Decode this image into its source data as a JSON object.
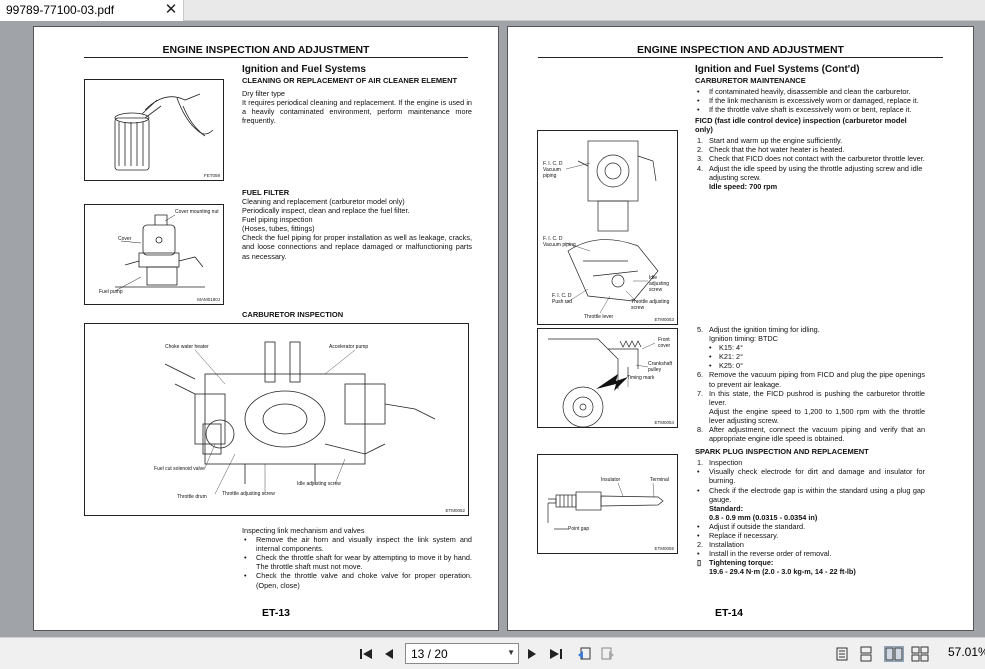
{
  "tab": {
    "title": "99789-77100-03.pdf",
    "close_label": "✕"
  },
  "left_page": {
    "header": "ENGINE INSPECTION AND ADJUSTMENT",
    "section_title": "Ignition and Fuel Systems",
    "air_cleaner": {
      "heading": "CLEANING OR REPLACEMENT OF AIR CLEANER ELEMENT",
      "line1": "Dry filter type",
      "body": "It requires periodical cleaning and replacement. If the engine is used in a heavily contaminated environment, perform maintenance more frequently."
    },
    "fuel_filter": {
      "heading": "FUEL FILTER",
      "lines": [
        "Cleaning and replacement (carburetor model only)",
        "Periodically inspect, clean and replace the fuel filter.",
        "Fuel piping inspection",
        "(Hoses, tubes, fittings)",
        "Check the fuel piping for proper installation as well as leakage, cracks, and loose connections and replace damaged or malfunctioning parts as necessary."
      ]
    },
    "carb_heading": "CARBURETOR INSPECTION",
    "link_intro": "Inspecting link mechanism and valves",
    "link_bullets": [
      "Remove the air horn and visually inspect the link system and internal components.",
      "Check the throttle shaft for wear by attempting to move it by hand. The throttle shaft must not move.",
      "Check the throttle valve and choke valve for proper operation. (Open, close)"
    ],
    "fig1": {
      "code": "FET059"
    },
    "fig2": {
      "code": "MAM0180J",
      "labels": {
        "cover_nut": "Cover mounting nut",
        "cover": "Cover",
        "pump": "Fuel pump"
      }
    },
    "fig3": {
      "code": "ETM0052",
      "labels": {
        "choke": "Choke water heater",
        "accel": "Accelerator pump",
        "solenoid": "Fuel cut solenoid valve",
        "drum": "Throttle drum",
        "adjusting": "Throttle adjusting screw",
        "idle": "Idle adjusting screw"
      }
    },
    "page_number": "ET-13"
  },
  "right_page": {
    "header": "ENGINE INSPECTION AND ADJUSTMENT",
    "section_title": "Ignition and Fuel Systems (Cont'd)",
    "carb_maint": {
      "heading": "CARBURETOR MAINTENANCE",
      "bullets": [
        "If contaminated heavily, disassemble and clean the carburetor.",
        "If the link mechanism is excessively worn or damaged, replace it.",
        "If the throttle valve shaft is excessively worn or bent, replace it."
      ]
    },
    "ficd": {
      "heading": "FICD (fast idle control device) inspection (carburetor model only)",
      "steps": [
        {
          "n": "1.",
          "t": "Start and warm up the engine sufficiently."
        },
        {
          "n": "2.",
          "t": "Check that the hot water heater is heated."
        },
        {
          "n": "3.",
          "t": "Check that FICD does not contact with the carburetor throttle lever."
        },
        {
          "n": "4.",
          "t": "Adjust the idle speed by using the throttle adjusting screw and idle adjusting screw."
        }
      ],
      "idle_speed": "Idle speed: 700 rpm"
    },
    "timing": {
      "step5": "Adjust the ignition timing for idling.",
      "timing_label": "Ignition timing: BTDC",
      "specs": [
        "K15: 4°",
        "K21: 2°",
        "K25: 0°"
      ],
      "steps": [
        {
          "n": "6.",
          "t": "Remove the vacuum piping from FICD and plug the pipe openings to prevent air leakage."
        },
        {
          "n": "7.",
          "t": "In this state, the FICD pushrod is pushing the carburetor throttle lever."
        }
      ],
      "step7b": "Adjust the engine speed to 1,200 to 1,500 rpm with the throttle lever adjusting screw.",
      "step8": "After adjustment, connect the vacuum piping and verify that an appropriate engine idle speed is obtained."
    },
    "spark": {
      "heading": "SPARK PLUG INSPECTION AND REPLACEMENT",
      "step1": "Inspection",
      "bullets_a": [
        "Visually check electrode for dirt and damage and insulator for burning.",
        "Check if the electrode gap is within the standard using a plug gap gauge."
      ],
      "standard_label": "Standard:",
      "standard_value": "0.8 - 0.9 mm (0.0315 - 0.0354 in)",
      "bullets_b": [
        "Adjust if outside the standard.",
        "Replace if necessary."
      ],
      "step2": "Installation",
      "install_bullet": "Install in the reverse order of removal.",
      "torque_label": "Tightening torque:",
      "torque_value": "19.6 - 29.4 N·m (2.0 - 3.0 kg-m, 14 - 22 ft-lb)"
    },
    "fig4": {
      "code": "ETM0053",
      "labels": {
        "ficd1": "F. I. C. D",
        "vac1": "Vacuum",
        "pip1": "piping",
        "ficd2": "F. I. C. D",
        "vac2": "Vacuum piping",
        "ficd3": "F. I. C. D",
        "push": "Push rod",
        "idle": "Idle",
        "idle2": "adjusting",
        "idle3": "screw",
        "tls1": "Throttle adjusting",
        "tls2": "screw",
        "lever": "Throttle lever"
      }
    },
    "fig5": {
      "code": "ETM0054",
      "labels": {
        "front": "Front",
        "cover": "cover",
        "crank": "Crankshaft",
        "pulley": "pulley",
        "mark": "Timing mark"
      }
    },
    "fig6": {
      "code": "ETM0055",
      "labels": {
        "insulator": "Insulator",
        "terminal": "Terminal",
        "gap": "Point gap"
      }
    },
    "page_number": "ET-14"
  },
  "toolbar": {
    "page_field": "13 / 20",
    "zoom": "57.01%"
  }
}
